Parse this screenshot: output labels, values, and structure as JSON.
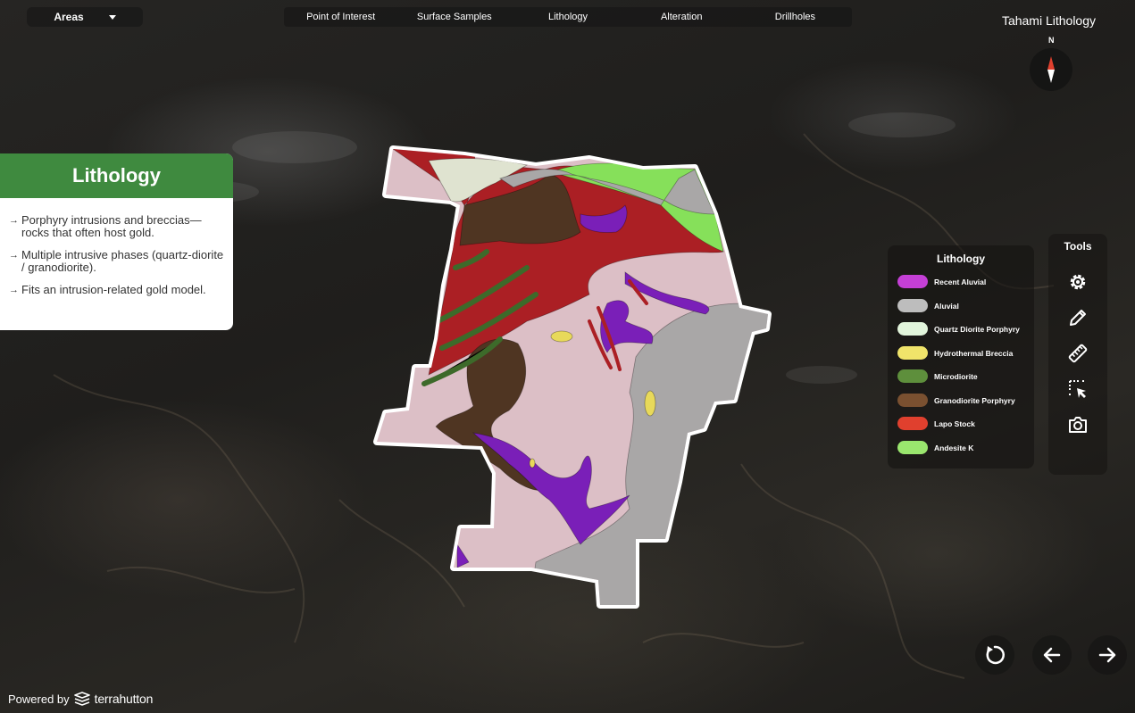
{
  "areas_dropdown": {
    "selected": "Areas"
  },
  "nav_tabs": [
    "Point of  Interest",
    "Surface  Samples",
    "Lithology",
    "Alteration",
    "Drillholes"
  ],
  "map_title": "Tahami Lithology",
  "compass": {
    "label": "N"
  },
  "info_card": {
    "title": "Lithology",
    "bullets": [
      "Porphyry intrusions and breccias—rocks that often host gold.",
      "Multiple intrusive phases (quartz-diorite / granodiorite).",
      "Fits an intrusion-related gold model."
    ]
  },
  "legend": {
    "title": "Lithology",
    "items": [
      {
        "label": "Recent Aluvial",
        "color": "#c43fd6"
      },
      {
        "label": "Aluvial",
        "color": "#bdbdbd"
      },
      {
        "label": "Quartz Diorite Porphyry",
        "color": "#e2f5dc"
      },
      {
        "label": "Hydrothermal Breccia",
        "color": "#f0e46a"
      },
      {
        "label": "Microdiorite",
        "color": "#5e8f3c"
      },
      {
        "label": "Granodiorite Porphyry",
        "color": "#7a5030"
      },
      {
        "label": "Lapo Stock",
        "color": "#e0402e"
      },
      {
        "label": "Andesite K",
        "color": "#9ae66e"
      }
    ]
  },
  "map_colors": {
    "pink": "#dcbfc6",
    "red": "#ab1f24",
    "brown": "#4f3522",
    "gray": "#a9a7a7",
    "purple": "#7a1fb8",
    "green": "#86e05a",
    "cream": "#dfe3d0",
    "dark_green": "#3d6a2a",
    "yellow": "#e8d95a"
  },
  "tools": {
    "title": "Tools",
    "icons": [
      "gear-icon",
      "pencil-icon",
      "ruler-icon",
      "select-icon",
      "camera-icon"
    ]
  },
  "footer": {
    "powered_by": "Powered by",
    "brand": "terrahutton"
  }
}
